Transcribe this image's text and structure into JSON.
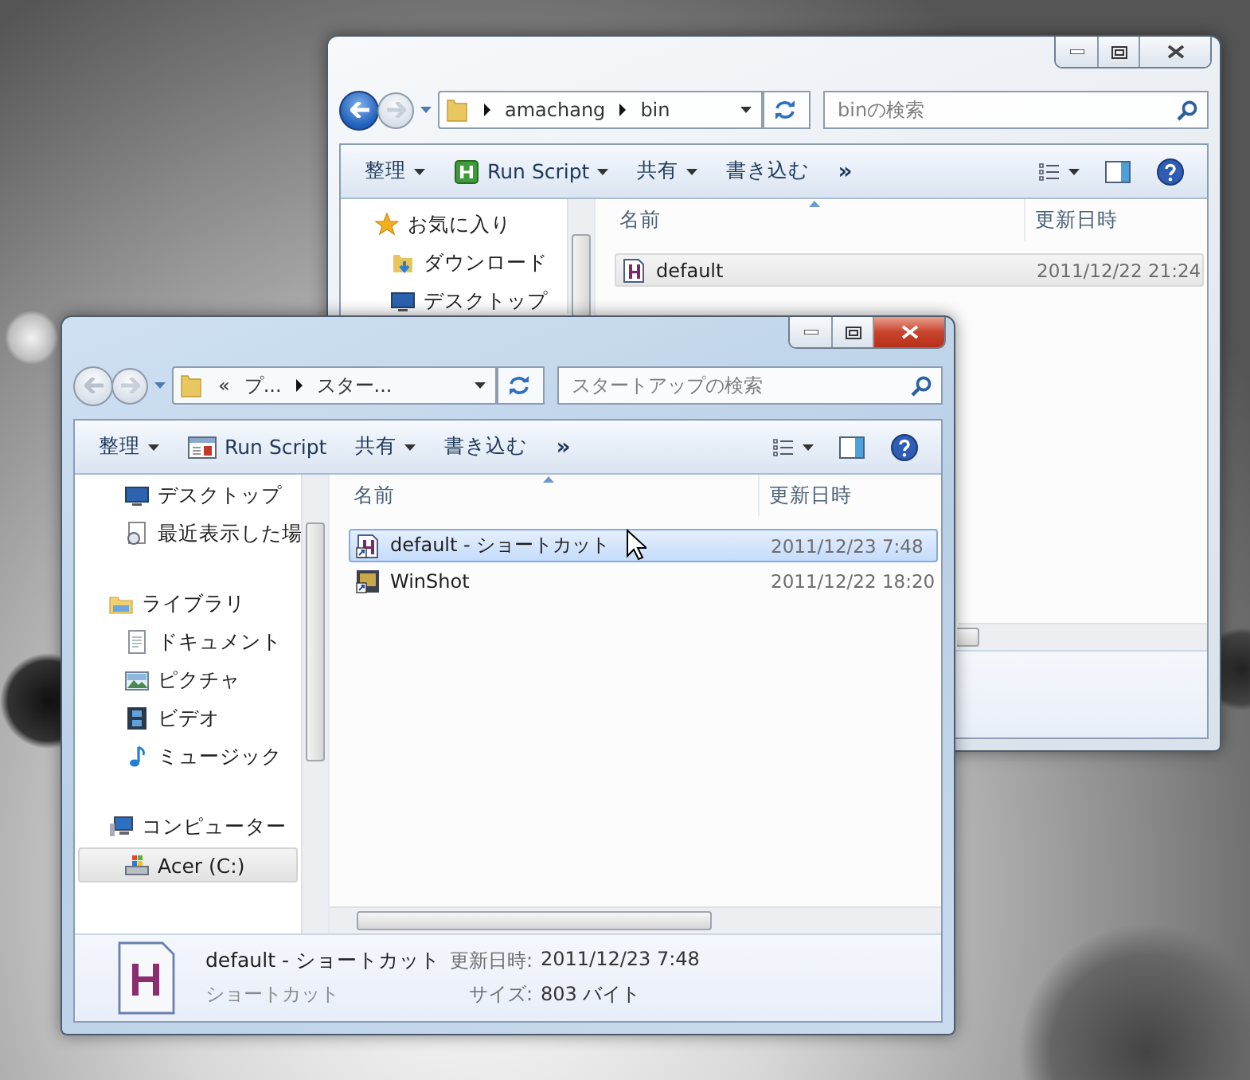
{
  "windows": [
    {
      "kind": "back",
      "nav": {
        "back_enabled": true,
        "forward_enabled": false
      },
      "address": {
        "segments": [
          "amachang",
          "bin"
        ]
      },
      "search": {
        "placeholder": "binの検索"
      },
      "toolbar": [
        {
          "kind": "menu",
          "label": "整理",
          "dropdown": true
        },
        {
          "kind": "script",
          "label": "Run Script",
          "dropdown": true
        },
        {
          "kind": "menu",
          "label": "共有",
          "dropdown": true
        },
        {
          "kind": "menu",
          "label": "書き込む",
          "dropdown": false
        },
        {
          "kind": "overflow",
          "label": "»",
          "dropdown": false
        }
      ],
      "sidebar": [
        {
          "kind": "favorites",
          "label": "お気に入り",
          "selected": false,
          "children": [
            {
              "kind": "downloads",
              "label": "ダウンロード",
              "selected": false
            },
            {
              "kind": "desktop",
              "label": "デスクトップ",
              "selected": false
            }
          ]
        }
      ],
      "columns": [
        "名前",
        "更新日時"
      ],
      "files": [
        {
          "kind": "script",
          "name": "default",
          "date": "2011/12/22 21:24",
          "selected": true
        }
      ]
    },
    {
      "kind": "front",
      "nav": {
        "back_enabled": false,
        "forward_enabled": false
      },
      "address": {
        "overflow": "«",
        "segments": [
          "プ...",
          "スター..."
        ]
      },
      "search": {
        "placeholder": "スタートアップの検索"
      },
      "toolbar": [
        {
          "kind": "menu",
          "label": "整理",
          "dropdown": true
        },
        {
          "kind": "app",
          "label": "Run Script",
          "dropdown": false
        },
        {
          "kind": "menu",
          "label": "共有",
          "dropdown": true
        },
        {
          "kind": "menu",
          "label": "書き込む",
          "dropdown": false
        },
        {
          "kind": "overflow",
          "label": "»",
          "dropdown": false
        }
      ],
      "sidebar": [
        {
          "children": [
            {
              "kind": "desktop",
              "label": "デスクトップ",
              "selected": false
            },
            {
              "kind": "recent",
              "label": "最近表示した場",
              "selected": false
            }
          ]
        },
        {
          "kind": "library",
          "label": "ライブラリ",
          "selected": false,
          "children": [
            {
              "kind": "documents",
              "label": "ドキュメント",
              "selected": false
            },
            {
              "kind": "pictures",
              "label": "ピクチャ",
              "selected": false
            },
            {
              "kind": "videos",
              "label": "ビデオ",
              "selected": false
            },
            {
              "kind": "music",
              "label": "ミュージック",
              "selected": false
            }
          ]
        },
        {
          "kind": "computer",
          "label": "コンピューター",
          "selected": false,
          "children": [
            {
              "kind": "drive",
              "label": "Acer (C:)",
              "selected": true
            }
          ]
        }
      ],
      "columns": [
        "名前",
        "更新日時"
      ],
      "files": [
        {
          "kind": "shortcut",
          "name": "default - ショートカット",
          "date": "2011/12/23 7:48",
          "selected": true
        },
        {
          "kind": "app-shortcut",
          "name": "WinShot",
          "date": "2011/12/22 18:20",
          "selected": false
        }
      ],
      "details": {
        "kind": "script",
        "name": "default - ショートカット",
        "type": "ショートカット",
        "fields": [
          {
            "label": "更新日時:",
            "value": "2011/12/23 7:48"
          },
          {
            "label": "サイズ:",
            "value": "803 バイト"
          }
        ]
      }
    }
  ]
}
